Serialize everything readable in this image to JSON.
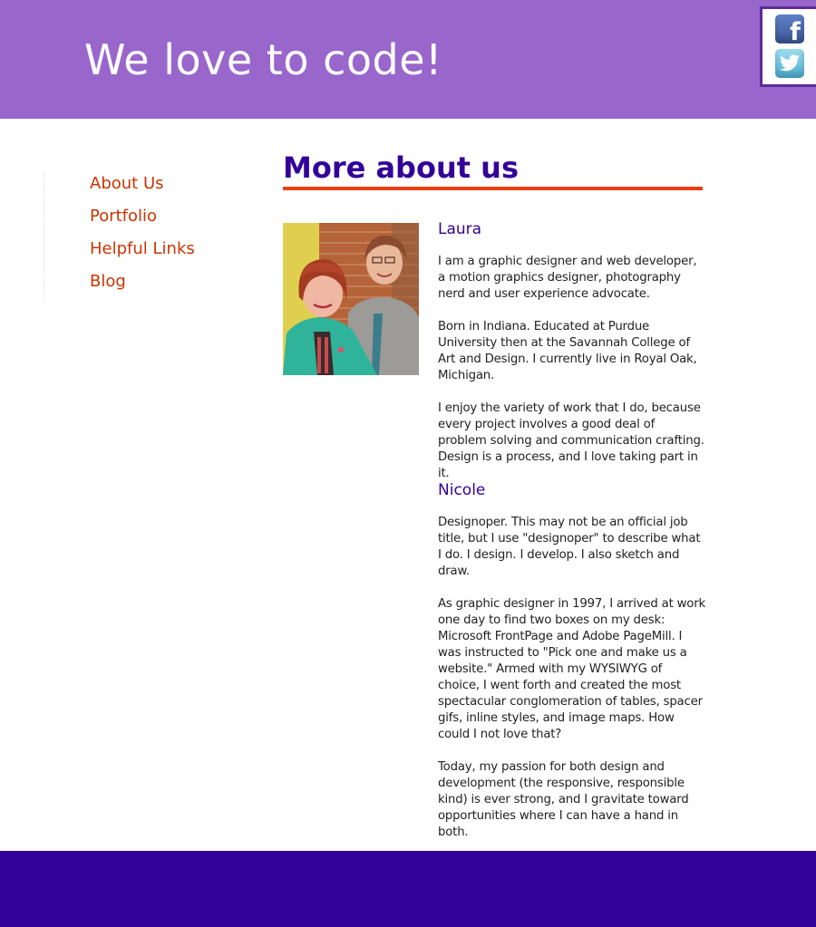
{
  "header": {
    "site_title": "We love to code!",
    "background_color": "#9966cc",
    "social": {
      "facebook_icon": "facebook-icon",
      "twitter_icon": "twitter-icon"
    }
  },
  "sidebar": {
    "items": [
      {
        "label": "About Us"
      },
      {
        "label": "Portfolio"
      },
      {
        "label": "Helpful Links"
      },
      {
        "label": "Blog"
      }
    ],
    "link_color": "#cc3300"
  },
  "main": {
    "title": "More about us",
    "accent_color": "#e8400f",
    "title_color": "#330099",
    "people": [
      {
        "name": "Laura",
        "paragraphs": [
          "I am a graphic designer and web developer, a motion graphics designer, photography nerd and user experience advocate.",
          "Born in Indiana. Educated at Purdue University then at the Savannah College of Art and Design. I currently live in Royal Oak, Michigan.",
          "I enjoy the variety of work that I do, because every project involves a good deal of problem solving and communication crafting. Design is a process, and I love taking part in it."
        ]
      },
      {
        "name": "Nicole",
        "paragraphs": [
          "Designoper. This may not be an official job title, but I use \"designoper\" to describe what I do. I design. I develop. I also sketch and draw.",
          "As graphic designer in 1997, I arrived at work one day to find two boxes on my desk: Microsoft FrontPage and Adobe PageMill. I was instructed to \"Pick one and make us a website.\" Armed with my WYSIWYG of choice, I went forth and created the most spectacular conglomeration of tables, spacer gifs, inline styles, and image maps. How could I not love that?",
          "Today, my passion for both design and development (the responsive, responsible kind) is ever strong, and I gravitate toward opportunities where I can have a hand in both."
        ]
      }
    ]
  },
  "footer": {
    "background_color": "#330099"
  }
}
